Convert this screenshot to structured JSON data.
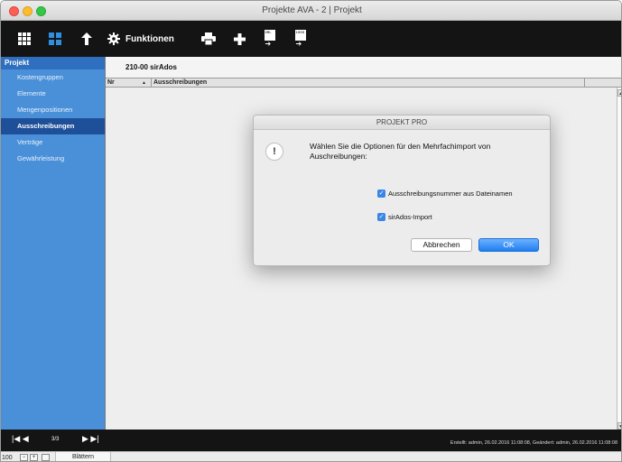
{
  "window": {
    "title": "Projekte AVA - 2 | Projekt"
  },
  "toolbar": {
    "functions_label": "Funktionen",
    "xml_icon_text": "XML",
    "doc_icon_text": "1000"
  },
  "sidebar": {
    "header": "Projekt",
    "items": [
      {
        "label": "Kostengruppen",
        "active": false
      },
      {
        "label": "Elemente",
        "active": false
      },
      {
        "label": "Mengenpositionen",
        "active": false
      },
      {
        "label": "Ausschreibungen",
        "active": true
      },
      {
        "label": "Verträge",
        "active": false
      },
      {
        "label": "Gewährleistung",
        "active": false
      }
    ]
  },
  "main": {
    "project_header": "210-00  sirAdos",
    "columns": {
      "nr": "Nr",
      "name": "Ausschreibungen"
    }
  },
  "dialog": {
    "title": "PROJEKT PRO",
    "message": "Wählen Sie die Optionen für den Mehrfachimport von Auschreibungen:",
    "options": [
      {
        "label": "Ausschreibungsnummer aus Dateinamen",
        "checked": true
      },
      {
        "label": "sirAdos-Import",
        "checked": true
      }
    ],
    "cancel_label": "Abbrechen",
    "ok_label": "OK"
  },
  "statusbar": {
    "record_count": "3/3",
    "status_text": "Erstellt: admin, 26.02.2016 11:08:08, Geändert: admin, 26.02.2016 11:08:08"
  },
  "bottombar": {
    "zoom_level": "100",
    "mode_label": "Blättern"
  },
  "colors": {
    "sidebar_bg": "#4a90d9",
    "sidebar_active": "#1e4f99",
    "toolbar_bg": "#141414",
    "accent_blue": "#2f8fe0",
    "ok_button": "#1f7ef0"
  }
}
